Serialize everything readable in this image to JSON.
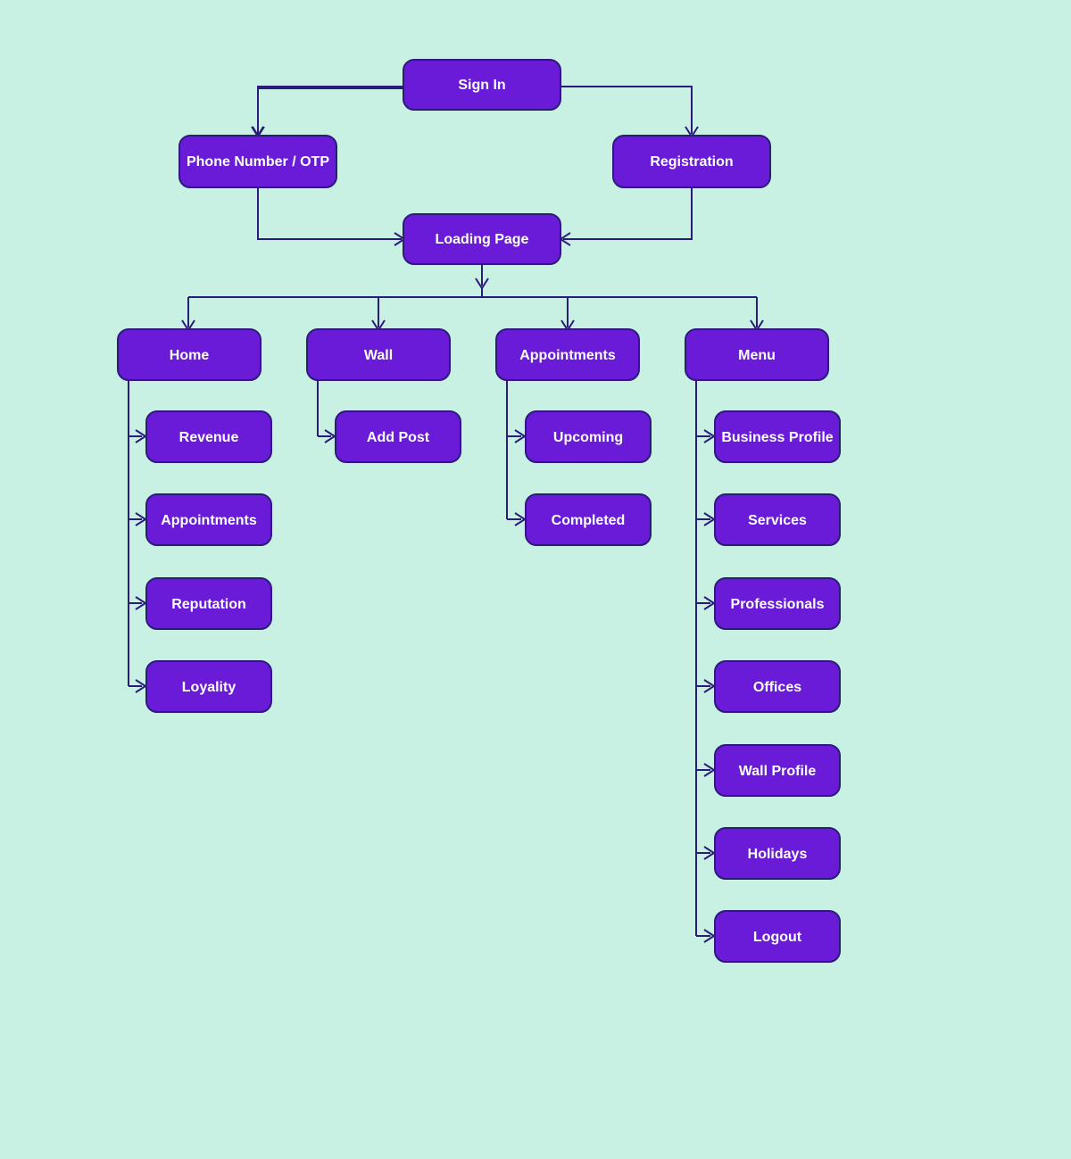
{
  "colors": {
    "bg": "#c9f1e3",
    "node_fill": "#6a1bd8",
    "stroke": "#2b1b7a",
    "text": "#ffffff"
  },
  "structure": {
    "root": "Sign In",
    "children": [
      {
        "name": "Phone Number / OTP",
        "children": [
          {
            "name": "Loading Page"
          }
        ]
      },
      {
        "name": "Registration",
        "children": [
          {
            "name": "Loading Page"
          }
        ]
      }
    ],
    "loading_page_children": [
      {
        "name": "Home",
        "children": [
          "Revenue",
          "Appointments",
          "Reputation",
          "Loyality"
        ]
      },
      {
        "name": "Wall",
        "children": [
          "Add Post"
        ]
      },
      {
        "name": "Appointments",
        "children": [
          "Upcoming",
          "Completed"
        ]
      },
      {
        "name": "Menu",
        "children": [
          "Business Profile",
          "Services",
          "Professionals",
          "Offices",
          "Wall Profile",
          "Holidays",
          "Logout"
        ]
      }
    ]
  },
  "nodes": {
    "sign_in": "Sign In",
    "phone_otp": "Phone Number / OTP",
    "registration": "Registration",
    "loading": "Loading Page",
    "home": "Home",
    "wall": "Wall",
    "appointments_tab": "Appointments",
    "menu": "Menu",
    "home_children": {
      "revenue": "Revenue",
      "appointments": "Appointments",
      "reputation": "Reputation",
      "loyality": "Loyality"
    },
    "wall_children": {
      "add_post": "Add Post"
    },
    "appt_children": {
      "upcoming": "Upcoming",
      "completed": "Completed"
    },
    "menu_children": {
      "business_profile": "Business Profile",
      "services": "Services",
      "professionals": "Professionals",
      "offices": "Offices",
      "wall_profile": "Wall Profile",
      "holidays": "Holidays",
      "logout": "Logout"
    }
  }
}
